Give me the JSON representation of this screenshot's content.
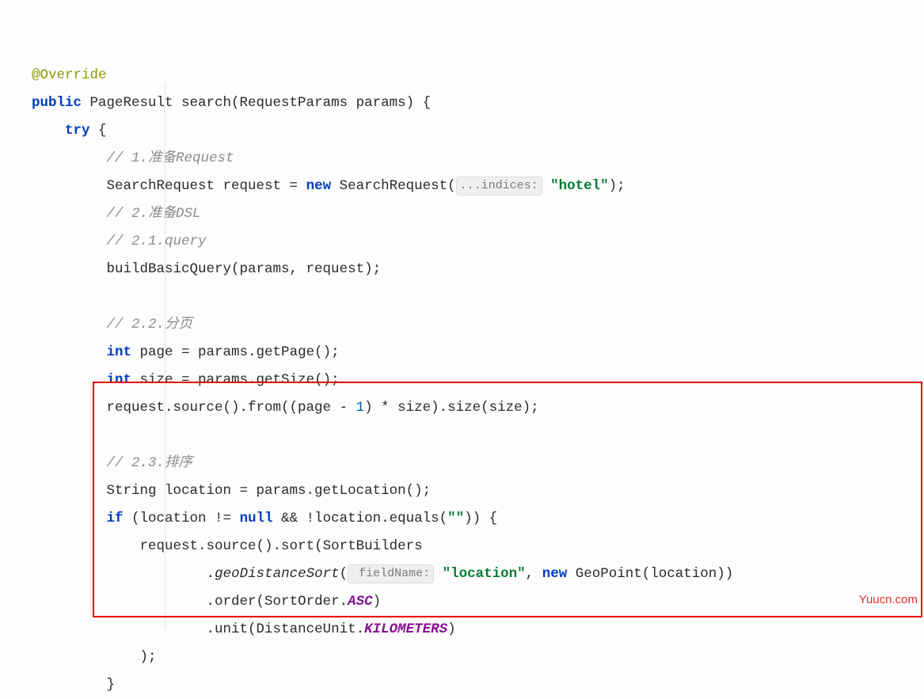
{
  "code": {
    "annotation": "@Override",
    "l1_kw": "public",
    "l1_rest": " PageResult search(RequestParams params) {",
    "l2_kw": "try",
    "l2_rest": " {",
    "c1": "// 1.准备Request",
    "l3a": "SearchRequest request = ",
    "l3_new": "new",
    "l3b": " SearchRequest(",
    "hint1": "...indices:",
    "l3_str": " \"hotel\"",
    "l3c": ");",
    "c2": "// 2.准备DSL",
    "c3": "// 2.1.query",
    "l4": "buildBasicQuery(params, request);",
    "c4": "// 2.2.分页",
    "l5_kw": "int",
    "l5_rest": " page = params.getPage();",
    "l6_kw": "int",
    "l6_rest": " size = params.getSize();",
    "l7a": "request.source().from((page - ",
    "l7_num": "1",
    "l7b": ") * size).size(size);",
    "c5": "// 2.3.排序",
    "l8": "String location = params.getLocation();",
    "l9_kw1": "if",
    "l9a": " (location != ",
    "l9_null": "null",
    "l9b": " && !location.equals(",
    "l9_str": "\"\"",
    "l9c": ")) {",
    "l10": "request.source().sort(SortBuilders",
    "l11_dot": ".",
    "l11_geo": "geoDistanceSort",
    "l11_open": "(",
    "hint2": " fieldName:",
    "l11_str": " \"location\"",
    "l11_mid": ", ",
    "l11_new": "new",
    "l11_rest": " GeoPoint(location))",
    "l12a": ".order(SortOrder.",
    "l12_const": "ASC",
    "l12b": ")",
    "l13a": ".unit(DistanceUnit.",
    "l13_const": "KILOMETERS",
    "l13b": ")",
    "l14": ");",
    "l15": "}"
  },
  "watermark": "Yuucn.com"
}
